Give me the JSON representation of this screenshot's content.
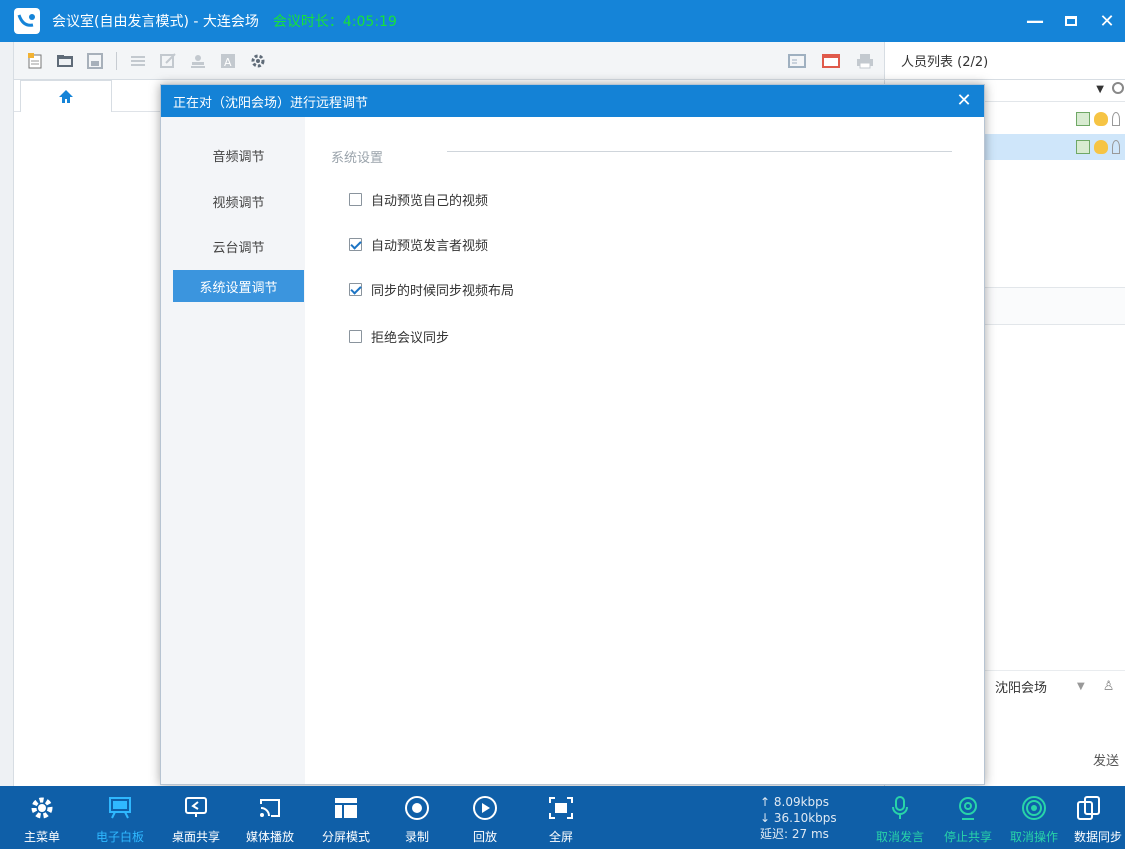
{
  "window": {
    "title": "会议室(自由发言模式) - 大连会场",
    "timer": "会议时长：4:05:19",
    "controls": [
      "—",
      "□",
      "✕"
    ]
  },
  "toolbar": {
    "left_icons": [
      "new-doc-icon",
      "open-folder-icon",
      "save-icon",
      "list-icon",
      "edit-icon",
      "stamp-icon",
      "text-icon",
      "settings-icon"
    ],
    "right_icons": [
      "layout-icon",
      "window-icon",
      "print-icon"
    ]
  },
  "people_panel": {
    "header": "人员列表 (2/2)",
    "venue_select": "沈阳会场",
    "send_label": "发送"
  },
  "dialog": {
    "title": "正在对（沈阳会场）进行远程调节",
    "side_items": [
      "音频调节",
      "视频调节",
      "云台调节",
      "系统设置调节"
    ],
    "active_index": 3,
    "section_title": "系统设置",
    "options": [
      {
        "label": "自动预览自己的视频",
        "checked": false
      },
      {
        "label": "自动预览发言者视频",
        "checked": true
      },
      {
        "label": "同步的时候同步视频布局",
        "checked": true
      },
      {
        "label": "拒绝会议同步",
        "checked": false
      }
    ]
  },
  "bottom_bar": {
    "left_items": [
      "主菜单",
      "电子白板",
      "桌面共享",
      "媒体播放",
      "分屏模式",
      "录制",
      "回放",
      "全屏"
    ],
    "network": {
      "up": "↑ 8.09kbps",
      "down": "↓ 36.10kbps",
      "latency": "延迟: 27 ms"
    },
    "right_items": [
      "取消发言",
      "停止共享",
      "取消操作",
      "数据同步"
    ]
  },
  "colors": {
    "titlebar": "#1584d8",
    "accent": "#3b95de",
    "bottombar": "#0f5fa8",
    "timer": "#16e23a"
  }
}
